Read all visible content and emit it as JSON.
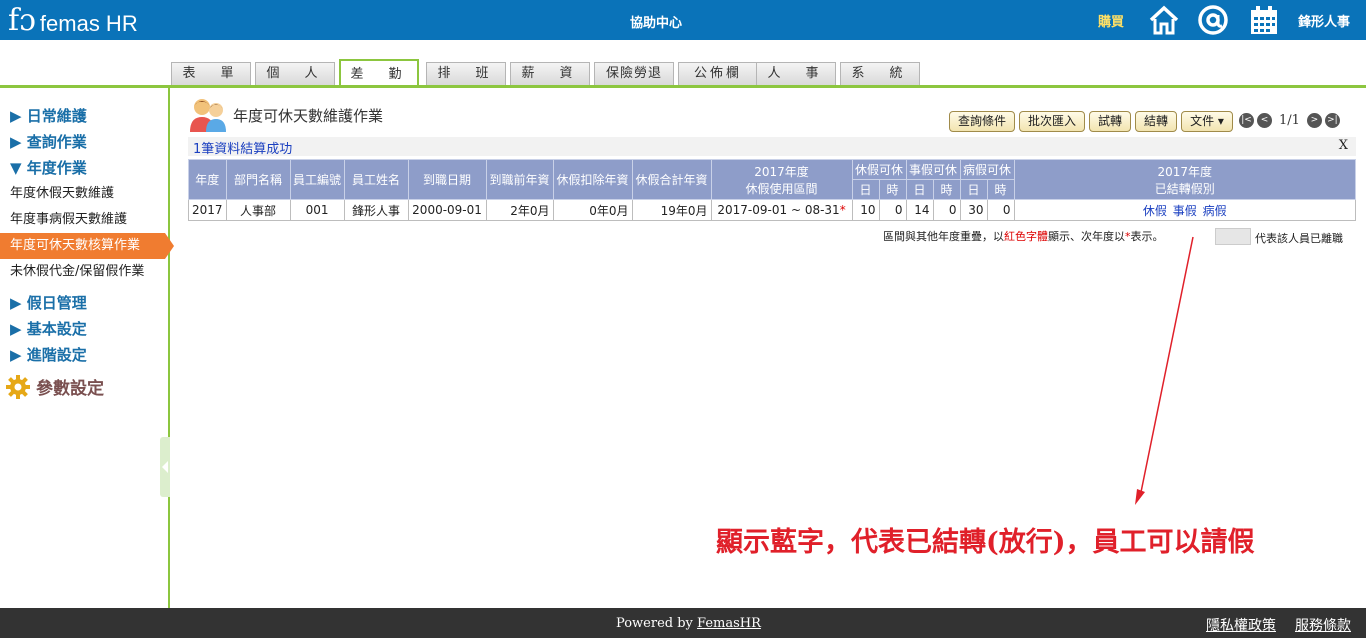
{
  "header": {
    "logo_mark": "fɔ",
    "logo_text": "femas HR",
    "center_title": "協助中心",
    "buy_label": "購買",
    "user_name": "鋒形人事",
    "icons": [
      "home-icon",
      "at-icon",
      "calendar-icon"
    ]
  },
  "tabs": [
    {
      "label": "表　單"
    },
    {
      "label": "個　人"
    },
    {
      "label": "差　勤",
      "active": true
    },
    {
      "label": "排　班"
    },
    {
      "label": "薪　資"
    },
    {
      "label": "保險勞退"
    },
    {
      "label": "公佈欄"
    },
    {
      "label": "人　事"
    },
    {
      "label": "系　統"
    }
  ],
  "sidebar": {
    "group_daily": "▶ 日常維護",
    "group_query": "▶ 查詢作業",
    "group_year": "▼ 年度作業",
    "items": [
      "年度休假天數維護",
      "年度事病假天數維護",
      "年度可休天數核算作業",
      "未休假代金/保留假作業"
    ],
    "group_holiday": "▶ 假日管理",
    "group_basic": "▶ 基本設定",
    "group_adv": "▶ 進階設定",
    "params": "參數設定"
  },
  "main": {
    "title": "年度可休天數維護作業",
    "toolbar": {
      "query": "查詢條件",
      "import": "批次匯入",
      "trial": "試轉",
      "close": "結轉",
      "docs": "文件 ▾"
    },
    "pager": {
      "text": "1/1"
    },
    "message": "1筆資料結算成功",
    "close_x": "X"
  },
  "table": {
    "headers": {
      "year": "年度",
      "dept": "部門名稱",
      "emp_no": "員工編號",
      "emp_name": "員工姓名",
      "hire_date": "到職日期",
      "pre_years": "到職前年資",
      "deduct_years": "休假扣除年資",
      "total_years": "休假合計年資",
      "period_1": "2017年度",
      "period_2": "休假使用區間",
      "annual": "休假可休",
      "personal": "事假可休",
      "sick": "病假可休",
      "day": "日",
      "hour": "時",
      "closed_1": "2017年度",
      "closed_2": "已結轉假別"
    },
    "row": {
      "year": "2017",
      "dept": "人事部",
      "emp_no": "001",
      "emp_name": "鋒形人事",
      "hire_date": "2000-09-01",
      "pre_years": "2年0月",
      "deduct_years": "0年0月",
      "total_years": "19年0月",
      "period": "2017-09-01 ~ 08-31",
      "star": "*",
      "annual_day": "10",
      "annual_hour": "0",
      "personal_day": "14",
      "personal_hour": "0",
      "sick_day": "30",
      "sick_hour": "0",
      "link_annual": "休假",
      "link_personal": "事假",
      "link_sick": "病假"
    }
  },
  "legend": {
    "part1": "區間與其他年度重疊，以",
    "red_text": "紅色字體",
    "part2": "顯示、次年度以",
    "star": "*",
    "part3": "表示。",
    "resigned": "代表該人員已離職"
  },
  "annotation": "顯示藍字，代表已結轉(放行)，員工可以請假",
  "footer": {
    "powered_prefix": "Powered by ",
    "powered_link": "FemasHR",
    "privacy": "隱私權政策",
    "terms": "服務條款"
  },
  "colors": {
    "header_blue": "#0a73b9",
    "tab_green": "#8cc63f",
    "active_orange": "#f07c30",
    "grid_header": "#8e9dc9",
    "link_blue": "#1a3fc0",
    "annotation_red": "#e0202a"
  }
}
